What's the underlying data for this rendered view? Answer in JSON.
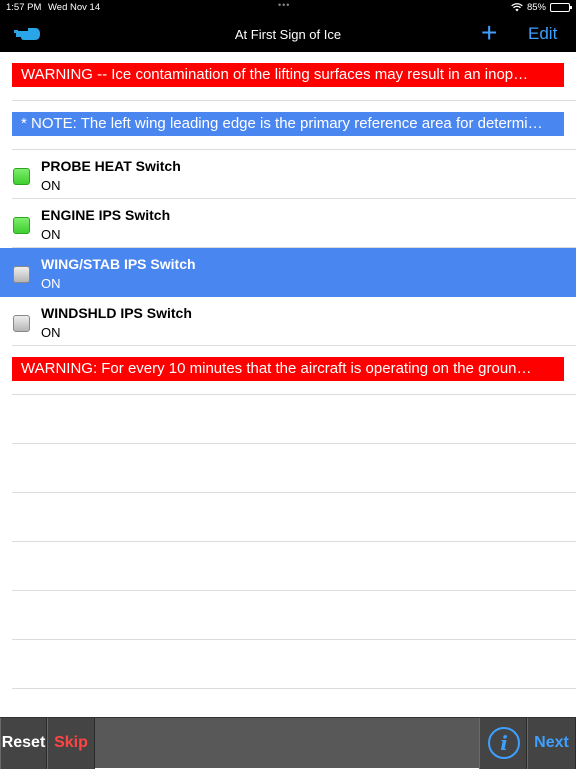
{
  "status": {
    "time": "1:57 PM",
    "date": "Wed Nov 14",
    "battery": "85%",
    "dots": "•••"
  },
  "nav": {
    "title": "At First Sign of Ice",
    "add_label": "+",
    "edit_label": "Edit",
    "back_icon": "pointing-hand-icon"
  },
  "items": [
    {
      "type": "banner",
      "color": "#ff0000",
      "text": "WARNING --  Ice contamination of the lifting surfaces may result in an inop…"
    },
    {
      "type": "banner",
      "color": "#4a86f0",
      "text": "* NOTE: The left wing leading edge is the primary reference area for determi…"
    },
    {
      "type": "check",
      "title": "PROBE HEAT Switch",
      "value": "ON",
      "status": "done"
    },
    {
      "type": "check",
      "title": "ENGINE IPS Switch",
      "value": "ON",
      "status": "done"
    },
    {
      "type": "check",
      "title": "WING/STAB IPS Switch",
      "value": "ON",
      "status": "current"
    },
    {
      "type": "check",
      "title": "WINDSHLD IPS Switch",
      "value": "ON",
      "status": "pending"
    },
    {
      "type": "banner",
      "color": "#ff0000",
      "text": "WARNING:  For every 10 minutes that the aircraft is operating on the groun…"
    }
  ],
  "toolbar": {
    "reset_label": "Reset",
    "skip_label": "Skip",
    "info_label": "i",
    "next_label": "Next"
  },
  "colors": {
    "accent": "#3ea0ff",
    "selected": "#4a86f0",
    "warning": "#ff0000",
    "done": "#3ecf2e"
  }
}
